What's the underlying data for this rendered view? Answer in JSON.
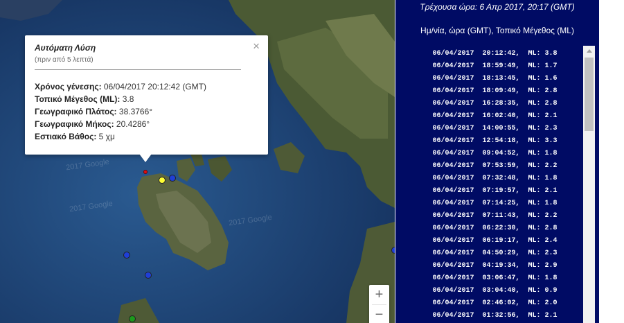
{
  "map": {
    "watermark": "2017 Google",
    "zoom_in": "+",
    "zoom_out": "−"
  },
  "popup": {
    "close": "×",
    "title": "Αυτόματη Λύση",
    "subtitle": "(πριν από 5 λεπτά)",
    "rows": [
      {
        "label": "Χρόνος γένεσης:",
        "value": " 06/04/2017  20:12:42 (GMT)"
      },
      {
        "label": "Τοπικό Μέγεθος (ML):",
        "value": " 3.8"
      },
      {
        "label": "Γεωγραφικό Πλάτος:",
        "value": " 38.3766°"
      },
      {
        "label": "Γεωγραφικό Μήκος:",
        "value": " 20.4286°"
      },
      {
        "label": "Εστιακό Βάθος:",
        "value": " 5 χμ"
      }
    ]
  },
  "panel": {
    "current_time": "Τρέχουσα ώρα: 6 Απρ 2017, 20:17 (GMT)",
    "column_header": "Ημ/νία, ώρα (GMT), Τοπικό Μέγεθος (ML)",
    "earthquakes": [
      "06/04/2017  20:12:42,  ML: 3.8",
      "06/04/2017  18:59:49,  ML: 1.7",
      "06/04/2017  18:13:45,  ML: 1.6",
      "06/04/2017  18:09:49,  ML: 2.8",
      "06/04/2017  16:28:35,  ML: 2.8",
      "06/04/2017  16:02:40,  ML: 2.1",
      "06/04/2017  14:00:55,  ML: 2.3",
      "06/04/2017  12:54:18,  ML: 3.3",
      "06/04/2017  09:04:52,  ML: 1.8",
      "06/04/2017  07:53:59,  ML: 2.2",
      "06/04/2017  07:32:48,  ML: 1.8",
      "06/04/2017  07:19:57,  ML: 2.1",
      "06/04/2017  07:14:25,  ML: 1.8",
      "06/04/2017  07:11:43,  ML: 2.2",
      "06/04/2017  06:22:30,  ML: 2.8",
      "06/04/2017  06:19:17,  ML: 2.4",
      "06/04/2017  04:50:29,  ML: 2.3",
      "06/04/2017  04:19:34,  ML: 2.9",
      "06/04/2017  03:06:47,  ML: 1.8",
      "06/04/2017  03:04:40,  ML: 0.9",
      "06/04/2017  02:46:02,  ML: 2.0",
      "06/04/2017  01:32:56,  ML: 2.1"
    ]
  },
  "colors": {
    "panel_bg": "#000b64",
    "marker_blue": "#1f3fd6",
    "marker_yellow": "#ffff33",
    "marker_green": "#1d9a1d",
    "marker_red": "#e01010"
  }
}
